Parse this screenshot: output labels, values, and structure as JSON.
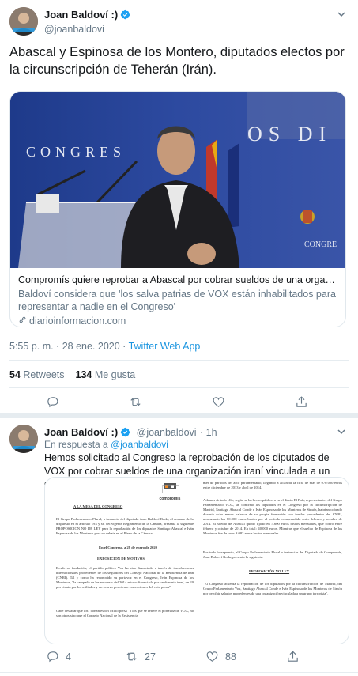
{
  "tweet": {
    "author_name": "Joan Baldoví :)",
    "author_handle": "@joanbaldovi",
    "text": "Abascal y Espinosa de los Montero, diputados electos por la circunscripción de Teherán (Irán).",
    "card": {
      "title": "Compromís quiere reprobar a Abascal por cobrar sueldos de una organización ir...",
      "description": "Baldoví considera que 'los salva patrias de VOX están inhabilitados para representar a nadie en el Congreso'",
      "domain": "diarioinformacion.com",
      "image_texts": {
        "congreso_left": "CONGRES",
        "congreso_right": "OS DI",
        "congreso_corner": "CONGRE"
      }
    },
    "time": "5:55 p. m. · 28 ene. 2020 · ",
    "source": "Twitter Web App",
    "retweets_count": "54",
    "retweets_label": "Retweets",
    "likes_count": "134",
    "likes_label": "Me gusta"
  },
  "reply": {
    "author_name": "Joan Baldoví :)",
    "author_handle": "@joanbaldovi",
    "time": "· 1h",
    "replying_prefix": "En respuesta a ",
    "replying_handle": "@joanbaldovi",
    "text": "Hemos solicitado al Congreso la reprobación de los diputados de VOX por cobrar sueldos de una organización iraní vinculada a un grupo terrorista.",
    "doc": {
      "logo": "compromis",
      "heading": "A LA MESA DEL CONGRESO",
      "para1": "El Grupo Parlamentario Plural, a instancia del diputado Joan Baldoví Roda, al amparo de lo dispuesto en el artículo 193 y ss. del vigente Reglamento de la Cámara, presenta la siguiente PROPOSICIÓN NO DE LEY para la reprobación de los diputados Santiago Abascal e Iván Espinosa de los Monteros para su debate en el Pleno de la Cámara.",
      "date": "En el Congreso, a 28 de enero de 2020",
      "motivos": "EXPOSICIÓN DE MOTIVOS",
      "para2": "Desde su fundación, el partido político Vox ha sido financiado a través de transferencias internacionales procedentes de los seguidores del Consejo Nacional de la Resistencia de Irán (CNRI). Tal y como ha reconocido su portavoz en el Congreso, Iván Espinosa de los Monteros, \"la campaña de las europeas del 2014 estuvo financiada por un donante iraní, un 20 por ciento por los afiliados y un octavo por ciento correcciones del voto pecas\".",
      "para3": "Cabe destacar que los \"donantes del exilio persa\" a los que se refiere el portavoz de VOX, no son otros sino que el Consejo Nacional de la Resistencia",
      "right1": "mes de partidos del arco parlamentario, llegando a alcanzar la cifra de más de 970.000 euros entre diciembre de 2013 y abril de 2014.",
      "right2": "Además de todo ello, según se ha hecho público a en el diario El País, representantes del Grupo Parlamentario VOX, un concreto los diputados en el Congreso por la circunscripción de Madrid, Santiago Abascal Conde e Iván Espinosa de los Monteros de Simón, habrían cobrado durante ocho meses salarios de su propia formación con fondos procedentes del CNRI, alcanzando los 80.000 euros brutos por el período comprendido entre febrero y octubre de 2014. El sueldo de Abascal quedó fijado en 5.600 euros brutos mensuales, que cobró entre febrero y octubre de 2014. En total: 40.000 euros. Mientras que el sueldo de Espinosa de los Monteros fue de unos 3.083 euros brutos mensuales.",
      "right3": "Por todo lo expuesto, el Grupo Parlamentario Plural a instancias del Diputado de Compromís, Joan Baldoví Roda, presenta la siguiente:",
      "right_heading": "PROPOSICIÓN NO LEY",
      "right4": "\"El Congreso acuerda la reprobación de los diputados por la circunscripción de Madrid, del Grupo Parlamentario Vox, Santiago Abascal Conde e Iván Espinosa de los Monteros de Simón por percibir salarios procedentes de una organización vinculada a un grupo terrorista\"."
    },
    "replies_count": "4",
    "retweets_count": "27",
    "likes_count": "88"
  },
  "colors": {
    "accent": "#1b95e0",
    "verified": "#1da1f2",
    "secondary_text": "#657786",
    "divider": "#e6ecf0"
  },
  "icons": [
    "verified-icon",
    "chevron-down-icon",
    "link-icon",
    "reply-icon",
    "retweet-icon",
    "like-icon",
    "share-icon"
  ]
}
